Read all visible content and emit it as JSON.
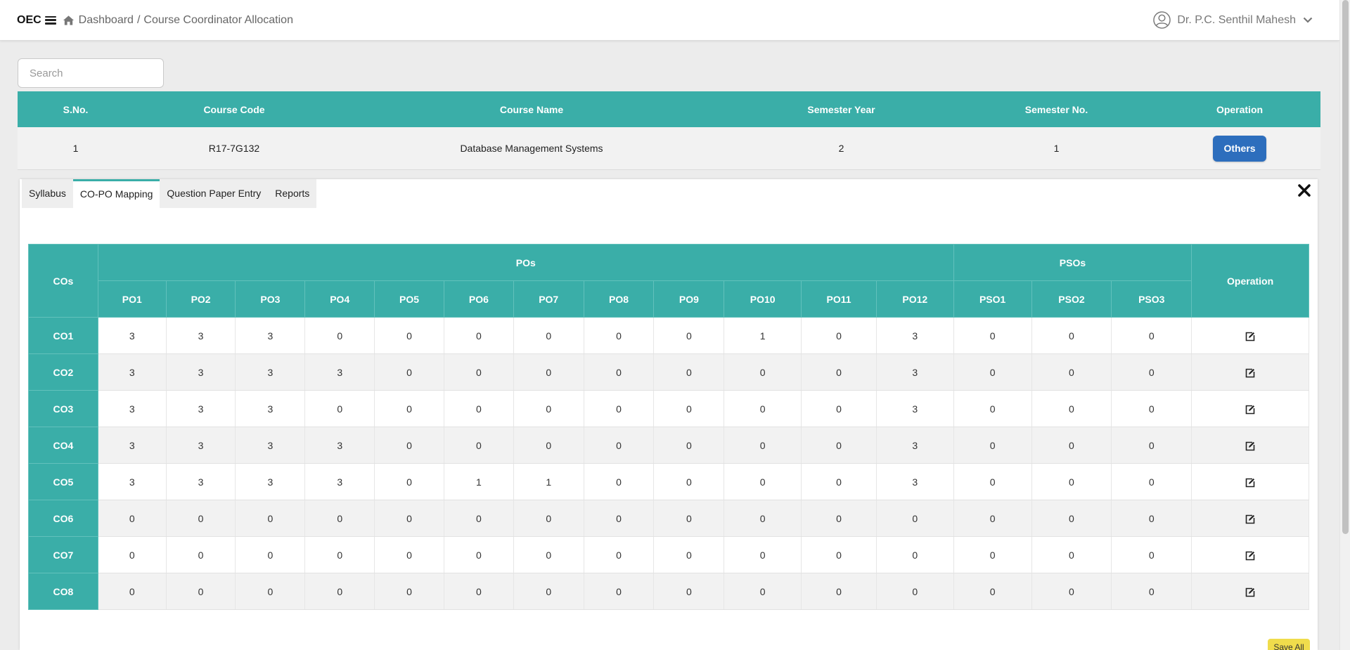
{
  "header": {
    "brand": "OEC",
    "breadcrumb": {
      "home": "Dashboard",
      "separator": "/",
      "current": "Course Coordinator Allocation"
    },
    "user_name": "Dr. P.C. Senthil Mahesh"
  },
  "search": {
    "placeholder": "Search",
    "value": ""
  },
  "course_table": {
    "headers": [
      "S.No.",
      "Course Code",
      "Course Name",
      "Semester Year",
      "Semester No.",
      "Operation"
    ],
    "row": {
      "sno": "1",
      "code": "R17-7G132",
      "name": "Database Management Systems",
      "year": "2",
      "sem": "1",
      "button": "Others"
    }
  },
  "tabs": [
    "Syllabus",
    "CO-PO Mapping",
    "Question Paper Entry",
    "Reports"
  ],
  "active_tab": "CO-PO Mapping",
  "mapping": {
    "corner": "COs",
    "po_group": "POs",
    "pso_group": "PSOs",
    "operation": "Operation",
    "po_cols": [
      "PO1",
      "PO2",
      "PO3",
      "PO4",
      "PO5",
      "PO6",
      "PO7",
      "PO8",
      "PO9",
      "PO10",
      "PO11",
      "PO12"
    ],
    "pso_cols": [
      "PSO1",
      "PSO2",
      "PSO3"
    ],
    "rows": [
      {
        "co": "CO1",
        "values": [
          "3",
          "3",
          "3",
          "0",
          "0",
          "0",
          "0",
          "0",
          "0",
          "1",
          "0",
          "3",
          "0",
          "0",
          "0"
        ]
      },
      {
        "co": "CO2",
        "values": [
          "3",
          "3",
          "3",
          "3",
          "0",
          "0",
          "0",
          "0",
          "0",
          "0",
          "0",
          "3",
          "0",
          "0",
          "0"
        ]
      },
      {
        "co": "CO3",
        "values": [
          "3",
          "3",
          "3",
          "0",
          "0",
          "0",
          "0",
          "0",
          "0",
          "0",
          "0",
          "3",
          "0",
          "0",
          "0"
        ]
      },
      {
        "co": "CO4",
        "values": [
          "3",
          "3",
          "3",
          "3",
          "0",
          "0",
          "0",
          "0",
          "0",
          "0",
          "0",
          "3",
          "0",
          "0",
          "0"
        ]
      },
      {
        "co": "CO5",
        "values": [
          "3",
          "3",
          "3",
          "3",
          "0",
          "1",
          "1",
          "0",
          "0",
          "0",
          "0",
          "3",
          "0",
          "0",
          "0"
        ]
      },
      {
        "co": "CO6",
        "values": [
          "0",
          "0",
          "0",
          "0",
          "0",
          "0",
          "0",
          "0",
          "0",
          "0",
          "0",
          "0",
          "0",
          "0",
          "0"
        ]
      },
      {
        "co": "CO7",
        "values": [
          "0",
          "0",
          "0",
          "0",
          "0",
          "0",
          "0",
          "0",
          "0",
          "0",
          "0",
          "0",
          "0",
          "0",
          "0"
        ]
      },
      {
        "co": "CO8",
        "values": [
          "0",
          "0",
          "0",
          "0",
          "0",
          "0",
          "0",
          "0",
          "0",
          "0",
          "0",
          "0",
          "0",
          "0",
          "0"
        ]
      }
    ]
  },
  "save_all": "Save All",
  "icons": {
    "menu": "hamburger-icon",
    "home": "home-icon",
    "user": "user-circle-icon",
    "dropdown": "chevron-down-icon",
    "close": "close-icon",
    "edit": "edit-icon"
  },
  "colors": {
    "teal": "#3aaea8",
    "button_blue": "#2d6ebd",
    "save_yellow": "#f0dc4c"
  }
}
